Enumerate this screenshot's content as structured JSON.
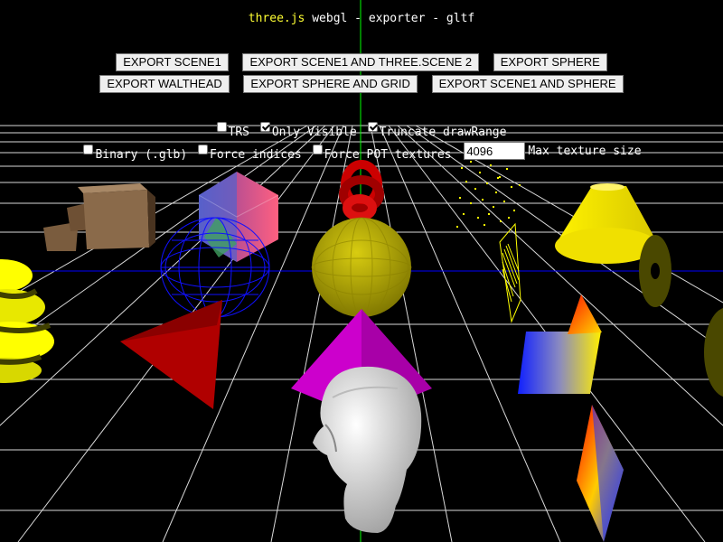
{
  "header": {
    "link_text": "three.js",
    "rest_text": " webgl - exporter - gltf"
  },
  "buttons": {
    "row1": [
      "EXPORT SCENE1",
      "EXPORT SCENE1 AND THREE.SCENE 2",
      "EXPORT SPHERE"
    ],
    "row2": [
      "EXPORT WALTHEAD",
      "EXPORT SPHERE AND GRID",
      "EXPORT SCENE1 AND SPHERE"
    ]
  },
  "options": {
    "trs": {
      "label": "TRS",
      "checked": false
    },
    "only_visible": {
      "label": "Only Visible",
      "checked": true
    },
    "truncate": {
      "label": "Truncate drawRange",
      "checked": true
    },
    "binary": {
      "label": "Binary (.glb)",
      "checked": false
    },
    "force_indices": {
      "label": "Force indices",
      "checked": false
    },
    "force_pot": {
      "label": "Force POT textures",
      "checked": false
    },
    "max_texture_value": "4096",
    "max_texture_label": "Max texture size"
  },
  "colors": {
    "background": "#000000",
    "link": "#ffff33",
    "grid": "#ffffff",
    "axis_blue": "#0000ff",
    "axis_green": "#00ff00"
  },
  "objects": [
    {
      "icon": "wooden-crate-icon",
      "color": "#8a6a4a"
    },
    {
      "icon": "textured-icosahedron-icon",
      "color": "#d04a6a"
    },
    {
      "icon": "red-torus-knot-icon",
      "color": "#cc0000"
    },
    {
      "icon": "yellow-sphere-icon",
      "color": "#bfb300"
    },
    {
      "icon": "point-cloud-icon",
      "color": "#ffff00"
    },
    {
      "icon": "yellow-cone-icon",
      "color": "#ffee00"
    },
    {
      "icon": "wireframe-sphere-icon",
      "color": "#0000ff"
    },
    {
      "icon": "yellow-lathe-spiral-icon",
      "color": "#ffff00"
    },
    {
      "icon": "red-triangle-icon",
      "color": "#cc0000"
    },
    {
      "icon": "magenta-pyramid-icon",
      "color": "#cc00cc"
    },
    {
      "icon": "walt-head-icon",
      "color": "#ffffff"
    },
    {
      "icon": "yellow-line-plane-icon",
      "color": "#ffff00"
    },
    {
      "icon": "gradient-plane-icon",
      "color": "#0000ff"
    },
    {
      "icon": "red-yellow-shard-icon",
      "color": "#ff2200"
    },
    {
      "icon": "dark-ring-icon",
      "color": "#555500"
    },
    {
      "icon": "gradient-diamond-icon",
      "color": "#ff6600"
    }
  ]
}
